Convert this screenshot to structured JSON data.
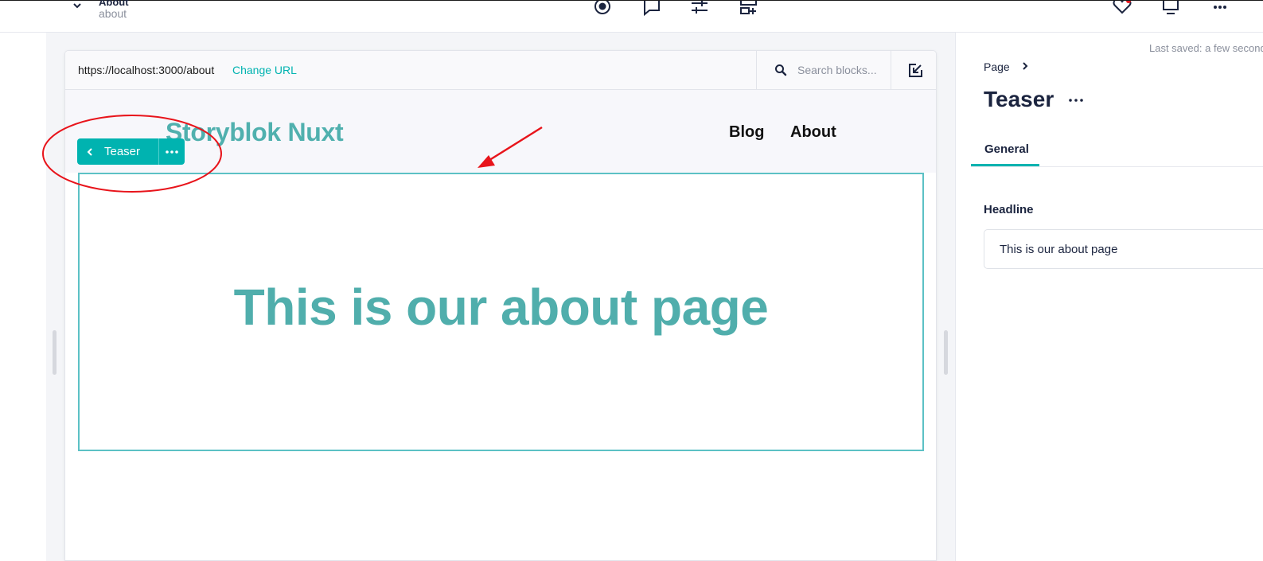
{
  "topbar": {
    "story_title": "About",
    "story_slug": "about"
  },
  "preview": {
    "url": "https://localhost:3000/about",
    "change_url_label": "Change URL",
    "search_placeholder": "Search blocks...",
    "site": {
      "logo": "Storyblok Nuxt",
      "nav": [
        "Blog",
        "About"
      ]
    },
    "teaser_headline": "This is our about page",
    "block_toolbar_label": "Teaser"
  },
  "panel": {
    "last_saved": "Last saved: a few seconds ago",
    "breadcrumb": "Page",
    "title": "Teaser",
    "tabs": [
      "General"
    ],
    "field": {
      "label": "Headline",
      "value": "This is our about page"
    }
  },
  "colors": {
    "accent": "#00b3b0",
    "site_teal": "#50aeac",
    "annotation_red": "#e8141b"
  }
}
